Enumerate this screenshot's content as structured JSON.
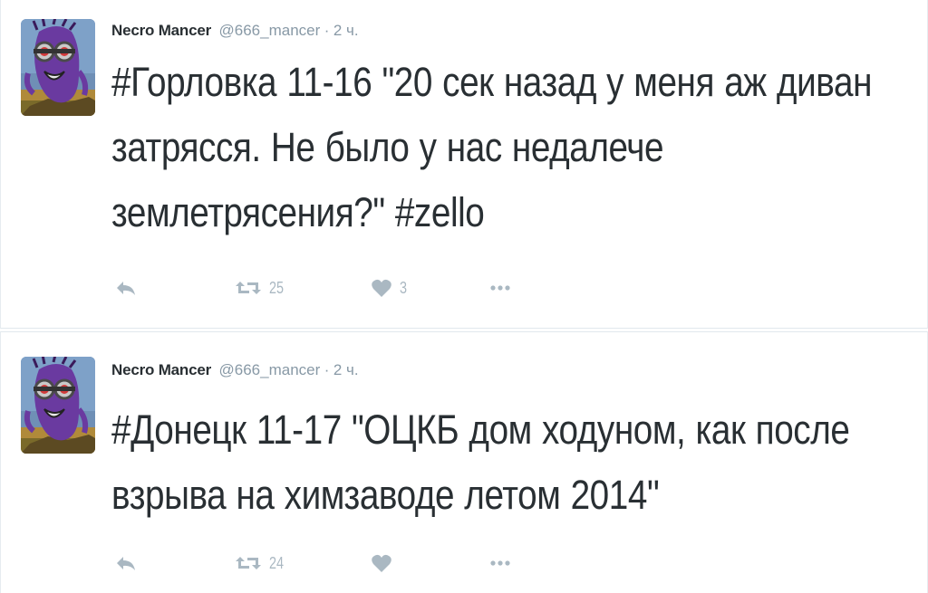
{
  "tweets": [
    {
      "author_name": "Necro Mancer",
      "author_handle": "@666_mancer",
      "separator": "·",
      "time": "2 ч.",
      "text": "#Горловка 11-16 \"20 сек назад у меня аж диван затрясся. Не было у нас недалече землетрясения?\" #zello",
      "retweets": "25",
      "likes": "3",
      "avatar_icon": "purple-minion-avatar",
      "icons": [
        "reply-icon",
        "retweet-icon",
        "heart-icon",
        "more-icon"
      ]
    },
    {
      "author_name": "Necro Mancer",
      "author_handle": "@666_mancer",
      "separator": "·",
      "time": "2 ч.",
      "text": "#Донецк 11-17 \"ОЦКБ дом ходуном, как после взрыва на химзаводе летом 2014\"",
      "retweets": "24",
      "likes": "",
      "avatar_icon": "purple-minion-avatar",
      "icons": [
        "reply-icon",
        "retweet-icon",
        "heart-icon",
        "more-icon"
      ]
    }
  ],
  "colors": {
    "text": "#292f33",
    "muted": "#8899a6",
    "icon": "#aab8c2",
    "border": "#e1e8ed"
  }
}
